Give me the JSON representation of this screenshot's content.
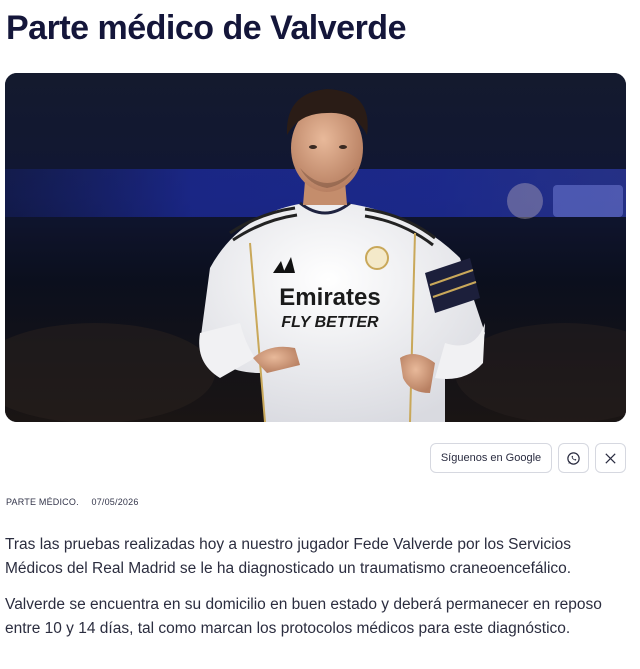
{
  "article": {
    "title": "Parte médico de Valverde",
    "image_alt": "Fede Valverde con la camiseta del Real Madrid",
    "jersey_sponsor_line1": "Emirates",
    "jersey_sponsor_line2": "FLY BETTER"
  },
  "actions": {
    "google_label": "Síguenos en Google",
    "whatsapp_icon": "whatsapp-icon",
    "x_icon": "x-icon"
  },
  "meta": {
    "category": "PARTE MÉDICO.",
    "date": "07/05/2026"
  },
  "body": {
    "paragraph_1": "Tras las pruebas realizadas hoy a nuestro jugador Fede Valverde por los Servicios Médicos del Real Madrid se le ha diagnosticado un traumatismo craneoencefálico.",
    "paragraph_2": "Valverde se encuentra en su domicilio en buen estado y deberá permanecer en reposo entre 10 y 14 días, tal como marcan los protocolos médicos para este diagnóstico."
  },
  "colors": {
    "title": "#14163a",
    "body_text": "#2b2d3f",
    "border": "#d6d8e0"
  }
}
